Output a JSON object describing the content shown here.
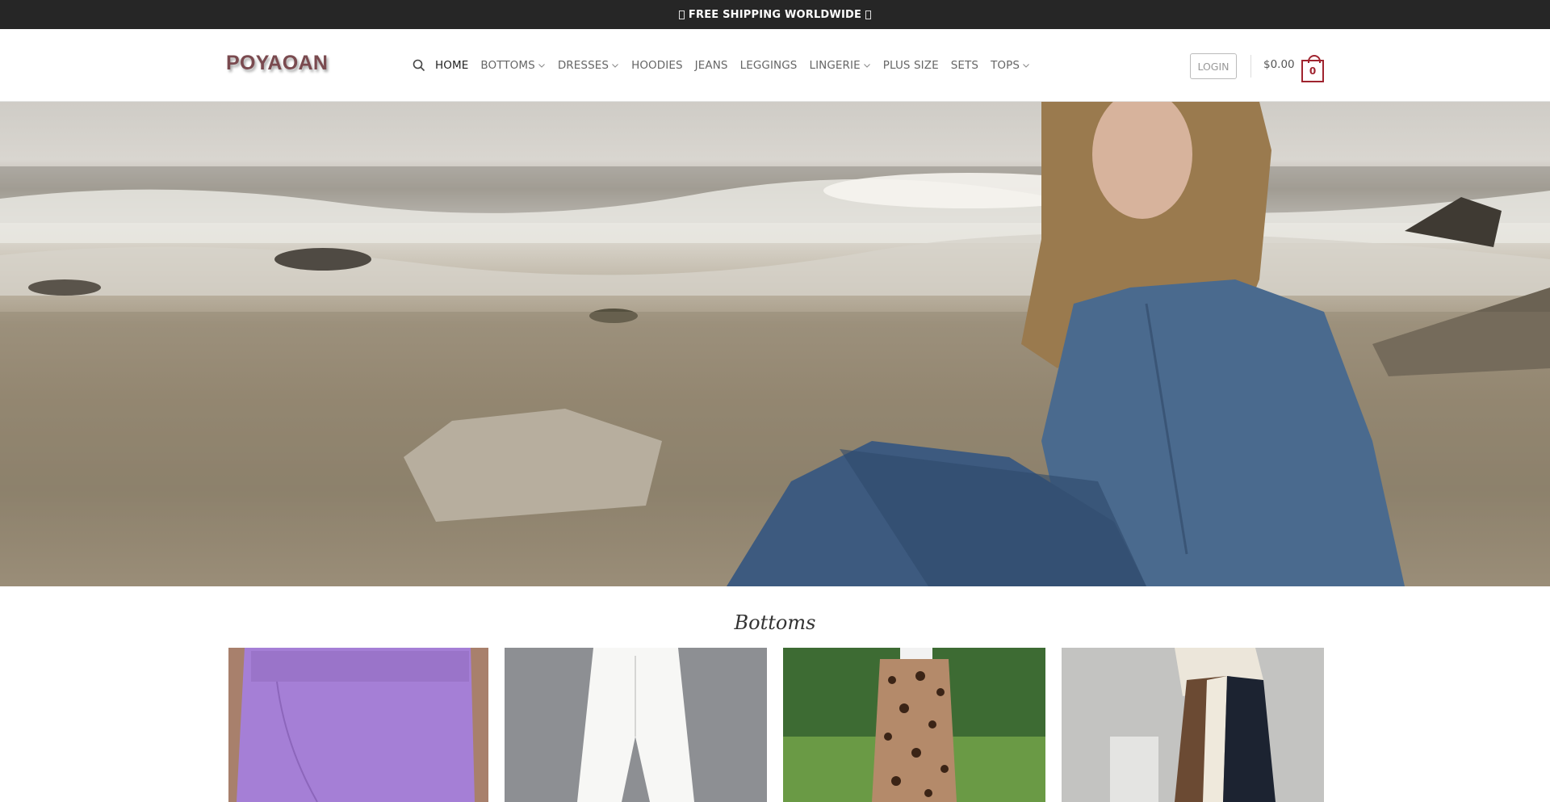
{
  "announcement": {
    "text": "FREE SHIPPING WORLDWIDE"
  },
  "header": {
    "logo": "POYAOAN",
    "nav": [
      {
        "label": "HOME",
        "dropdown": false
      },
      {
        "label": "BOTTOMS",
        "dropdown": true
      },
      {
        "label": "DRESSES",
        "dropdown": true
      },
      {
        "label": "HOODIES",
        "dropdown": false
      },
      {
        "label": "JEANS",
        "dropdown": false
      },
      {
        "label": "LEGGINGS",
        "dropdown": false
      },
      {
        "label": "LINGERIE",
        "dropdown": true
      },
      {
        "label": "PLUS SIZE",
        "dropdown": false
      },
      {
        "label": "SETS",
        "dropdown": false
      },
      {
        "label": "TOPS",
        "dropdown": true
      }
    ],
    "login_label": "LOGIN",
    "cart_total": "$0.00",
    "cart_count": "0"
  },
  "hero": {
    "image": "woman in denim jacket and jeans sitting on rocky beach"
  },
  "section": {
    "title": "Bottoms"
  },
  "products": [
    {
      "image": "purple shorts"
    },
    {
      "image": "white pants"
    },
    {
      "image": "leopard print skirt"
    },
    {
      "image": "colorblock wide leg pants"
    }
  ],
  "colors": {
    "topbar": "#262626",
    "accent": "#a0242f",
    "logo": "#7a4a4f"
  }
}
